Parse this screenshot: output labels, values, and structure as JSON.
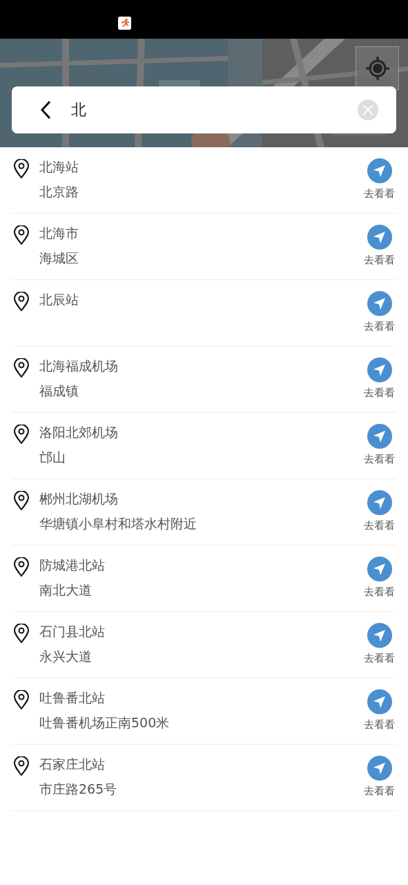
{
  "search": {
    "value": "北"
  },
  "results": [
    {
      "name": "北海站",
      "address": "北京路",
      "action": "去看看"
    },
    {
      "name": "北海市",
      "address": "海城区",
      "action": "去看看"
    },
    {
      "name": "北辰站",
      "action": "去看看"
    },
    {
      "name": "北海福成机场",
      "address": "福成镇",
      "action": "去看看"
    },
    {
      "name": "洛阳北郊机场",
      "address": "邙山",
      "action": "去看看"
    },
    {
      "name": "郴州北湖机场",
      "address": "华塘镇小阜村和塔水村附近",
      "action": "去看看"
    },
    {
      "name": "防城港北站",
      "address": "南北大道",
      "action": "去看看"
    },
    {
      "name": "石门县北站",
      "address": "永兴大道",
      "action": "去看看"
    },
    {
      "name": "吐鲁番北站",
      "address": "吐鲁番机场正南500米",
      "action": "去看看"
    },
    {
      "name": "石家庄北站",
      "address": "市庄路265号",
      "action": "去看看"
    }
  ]
}
